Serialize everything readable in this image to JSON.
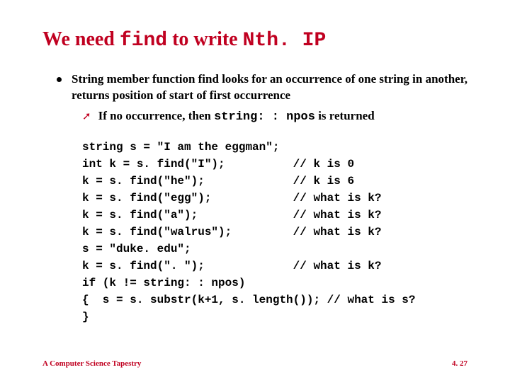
{
  "title": {
    "part1": "We need ",
    "code1": "find",
    "part2": " to write ",
    "code2": "Nth. IP"
  },
  "bullet": {
    "text": "String member function find looks for an occurrence of one string in another, returns position of start of first occurrence"
  },
  "sub": {
    "part1": "If no occurrence, then ",
    "code": "string: : npos",
    "part2": " is returned"
  },
  "code": {
    "l0": "string s = \"I am the eggman\";",
    "l1": "int k = s. find(\"I\");          // k is 0",
    "l2": "k = s. find(\"he\");             // k is 6",
    "l3": "k = s. find(\"egg\");            // what is k?",
    "l4": "k = s. find(\"a\");              // what is k?",
    "l5": "k = s. find(\"walrus\");         // what is k?",
    "l6": "s = \"duke. edu\";",
    "l7": "k = s. find(\". \");             // what is k?",
    "l8": "if (k != string: : npos)",
    "l9": "{  s = s. substr(k+1, s. length()); // what is s?",
    "l10": "}"
  },
  "footer": {
    "left": "A Computer Science Tapestry",
    "right": "4. 27"
  },
  "chart_data": {
    "type": "table",
    "title": "We need find to write Nth. IP",
    "bullets": [
      "String member function find looks for an occurrence of one string in another, returns position of start of first occurrence",
      "If no occurrence, then string::npos is returned"
    ],
    "code_lines": [
      "string s = \"I am the eggman\";",
      "int k = s. find(\"I\");          // k is 0",
      "k = s. find(\"he\");             // k is 6",
      "k = s. find(\"egg\");            // what is k?",
      "k = s. find(\"a\");              // what is k?",
      "k = s. find(\"walrus\");         // what is k?",
      "s = \"duke. edu\";",
      "k = s. find(\". \");             // what is k?",
      "if (k != string: : npos)",
      "{  s = s. substr(k+1, s. length()); // what is s?",
      "}"
    ],
    "footer_left": "A Computer Science Tapestry",
    "footer_right": "4. 27"
  }
}
